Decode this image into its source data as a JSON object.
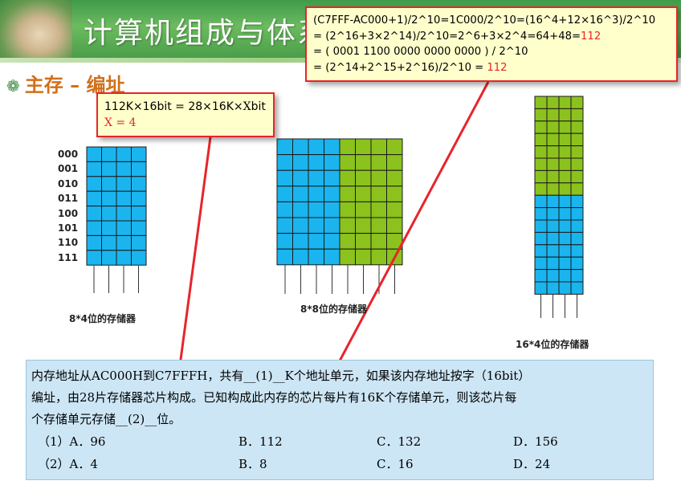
{
  "header": {
    "title": "计算机组成与体系"
  },
  "section_title": "主存 – 编址",
  "callout_top": {
    "line1": "(C7FFF-AC000+1)/2^10=1C000/2^10=(16^4+12×16^3)/2^10",
    "line2_prefix": "= (2^16+3×2^14)/2^10=2^6+3×2^4=64+48=",
    "line2_result": "112",
    "line3": "= ( 0001 1100 0000 0000 0000 ) / 2^10",
    "line4_prefix": "= (2^14+2^15+2^16)/2^10 = ",
    "line4_result": "112"
  },
  "callout_left": {
    "line1_prefix": "112K×16bit = 28×16K×",
    "line1_x": "X",
    "line1_suffix": "bit",
    "line2": "X = 4"
  },
  "diagram": {
    "addresses": [
      "000",
      "001",
      "010",
      "011",
      "100",
      "101",
      "110",
      "111"
    ],
    "caption_8x4": "8*4位的存储器",
    "caption_8x8": "8*8位的存储器",
    "caption_16x4": "16*4位的存储器",
    "color_blue": "#1ab5ee",
    "color_green": "#8cc21d",
    "color_arrow": "#e8242b"
  },
  "question": {
    "line1": "内存地址从AC000H到C7FFFH，共有__(1)__K个地址单元，如果该内存地址按字（16bit）",
    "line2": "编址，由28片存储器芯片构成。已知构成此内存的芯片每片有16K个存储单元，则该芯片每",
    "line3": "个存储单元存储__(2)__位。",
    "options_1": [
      "（1）A．96",
      "B．112",
      "C．132",
      "D．156"
    ],
    "options_2": [
      "（2）A．4",
      "B．8",
      "C．16",
      "D．24"
    ]
  }
}
